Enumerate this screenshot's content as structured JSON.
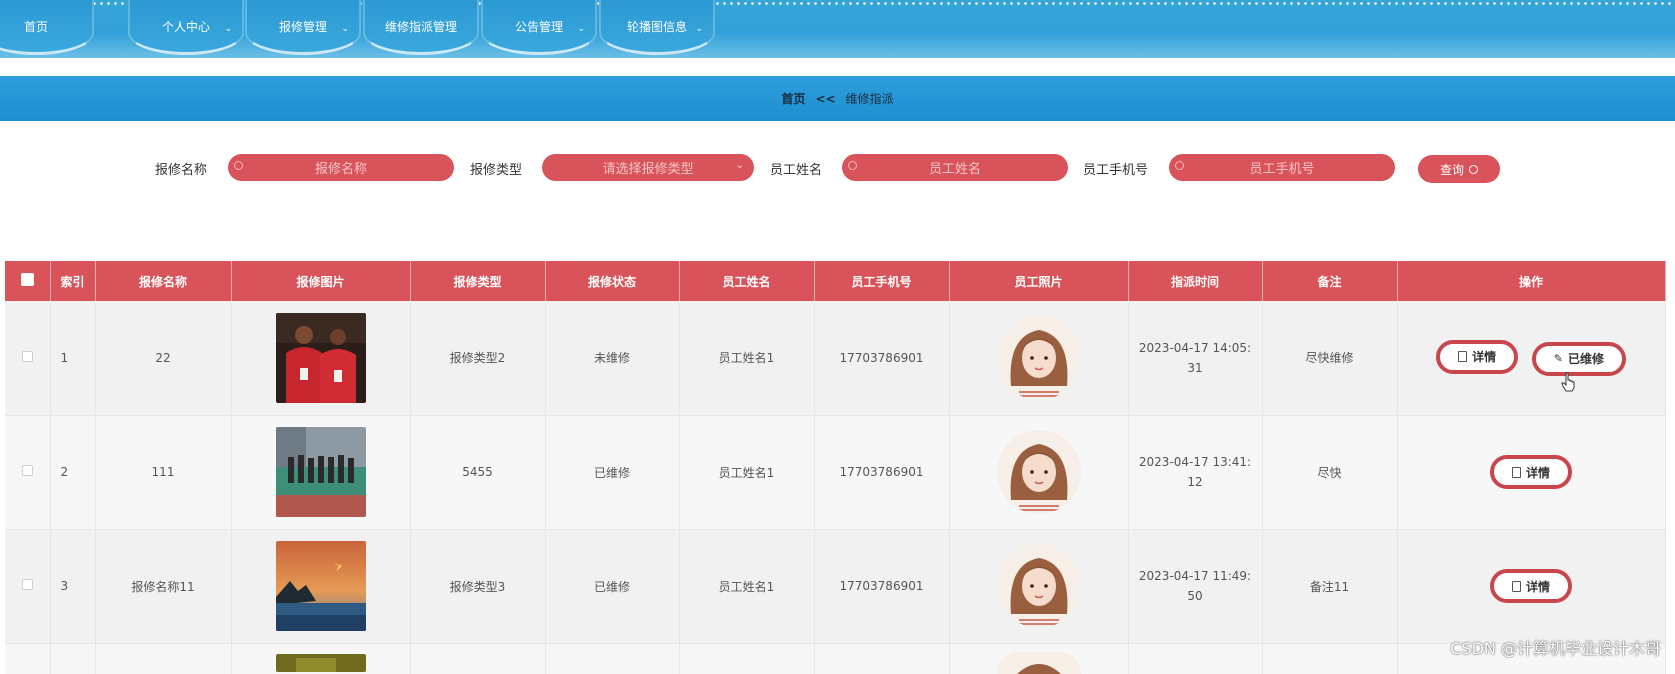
{
  "nav": {
    "items": [
      {
        "label": "首页",
        "has_dropdown": false
      },
      {
        "label": "个人中心",
        "has_dropdown": true
      },
      {
        "label": "报修管理",
        "has_dropdown": true
      },
      {
        "label": "维修指派管理",
        "has_dropdown": false
      },
      {
        "label": "公告管理",
        "has_dropdown": true
      },
      {
        "label": "轮播图信息",
        "has_dropdown": true
      }
    ]
  },
  "breadcrumb": {
    "home": "首页",
    "separator": "<<",
    "current": "维修指派"
  },
  "search": {
    "fields": [
      {
        "label": "报修名称",
        "placeholder": "报修名称"
      },
      {
        "label": "报修类型",
        "placeholder": "请选择报修类型"
      },
      {
        "label": "员工姓名",
        "placeholder": "员工姓名"
      },
      {
        "label": "员工手机号",
        "placeholder": "员工手机号"
      }
    ],
    "query_label": "查询"
  },
  "table": {
    "headers": [
      "索引",
      "报修名称",
      "报修图片",
      "报修类型",
      "报修状态",
      "员工姓名",
      "员工手机号",
      "员工照片",
      "指派时间",
      "备注",
      "操作"
    ],
    "rows": [
      {
        "index": "1",
        "name": "22",
        "type": "报修类型2",
        "status": "未维修",
        "employee": "员工姓名1",
        "phone": "17703786901",
        "time_line1": "2023-04-17 14:05:",
        "time_line2": "31",
        "note": "尽快维修",
        "actions": [
          "详情",
          "已维修"
        ]
      },
      {
        "index": "2",
        "name": "111",
        "type": "5455",
        "status": "已维修",
        "employee": "员工姓名1",
        "phone": "17703786901",
        "time_line1": "2023-04-17 13:41:",
        "time_line2": "12",
        "note": "尽快",
        "actions": [
          "详情"
        ]
      },
      {
        "index": "3",
        "name": "报修名称11",
        "type": "报修类型3",
        "status": "已维修",
        "employee": "员工姓名1",
        "phone": "17703786901",
        "time_line1": "2023-04-17 11:49:",
        "time_line2": "50",
        "note": "备注11",
        "actions": [
          "详情"
        ]
      }
    ]
  },
  "watermark": "CSDN @计算机毕业设计木哥",
  "colors": {
    "nav_blue": "#2f9fd8",
    "accent_red": "#d9545a",
    "button_border": "#c7474d"
  }
}
